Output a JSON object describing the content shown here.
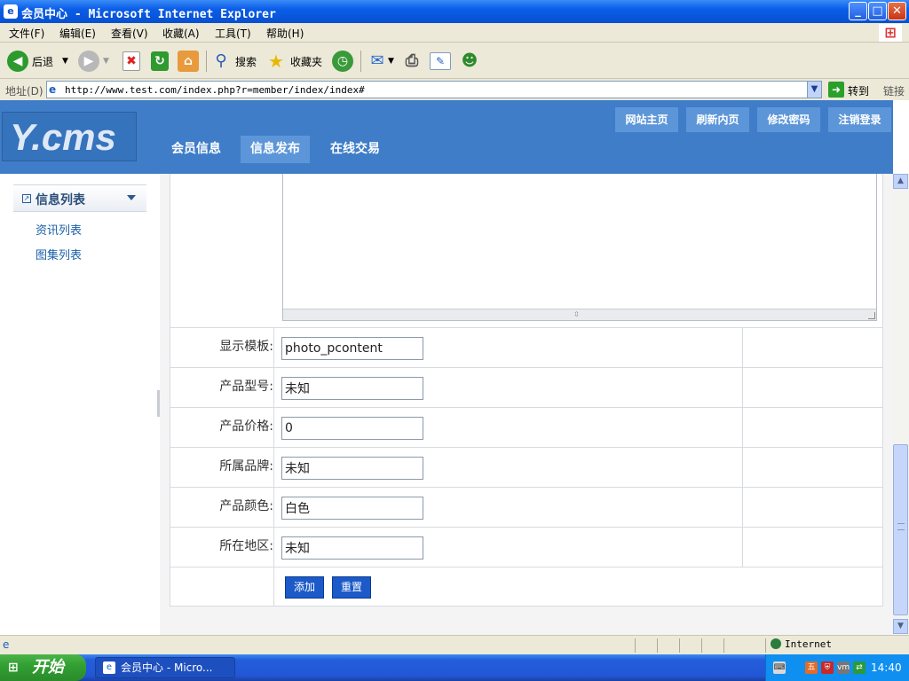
{
  "window": {
    "title": "会员中心 - Microsoft Internet Explorer",
    "minimize": "_",
    "maximize": "□",
    "close": "✕"
  },
  "menu": [
    {
      "label": "文件(F)"
    },
    {
      "label": "编辑(E)"
    },
    {
      "label": "查看(V)"
    },
    {
      "label": "收藏(A)"
    },
    {
      "label": "工具(T)"
    },
    {
      "label": "帮助(H)"
    }
  ],
  "toolbar": {
    "back_label": "后退",
    "search_label": "搜索",
    "favorites_label": "收藏夹"
  },
  "address": {
    "label": "地址(D)",
    "url": "http://www.test.com/index.php?r=member/index/index#",
    "go_label": "转到",
    "links_label": "链接"
  },
  "site": {
    "logo_text": "Y.cms",
    "top_buttons": [
      "网站主页",
      "刷新内页",
      "修改密码",
      "注销登录"
    ],
    "nav_tabs": [
      "会员信息",
      "信息发布",
      "在线交易"
    ],
    "active_tab": "信息发布"
  },
  "sidebar": {
    "title": "信息列表",
    "items": [
      "资讯列表",
      "图集列表"
    ]
  },
  "form": {
    "rows": [
      {
        "label": "显示模板:",
        "value": "photo_pcontent"
      },
      {
        "label": "产品型号:",
        "value": "未知"
      },
      {
        "label": "产品价格:",
        "value": "0"
      },
      {
        "label": "所属品牌:",
        "value": "未知"
      },
      {
        "label": "产品颜色:",
        "value": "白色"
      },
      {
        "label": "所在地区:",
        "value": "未知"
      }
    ],
    "submit_label": "添加",
    "reset_label": "重置"
  },
  "status": {
    "zone": "Internet"
  },
  "taskbar": {
    "start_label": "开始",
    "task_label": "会员中心 - Micro...",
    "clock": "14:40"
  },
  "colors": {
    "header_blue": "#3f7dc8",
    "button_blue": "#5c96d9",
    "form_button": "#1b5ac8"
  }
}
